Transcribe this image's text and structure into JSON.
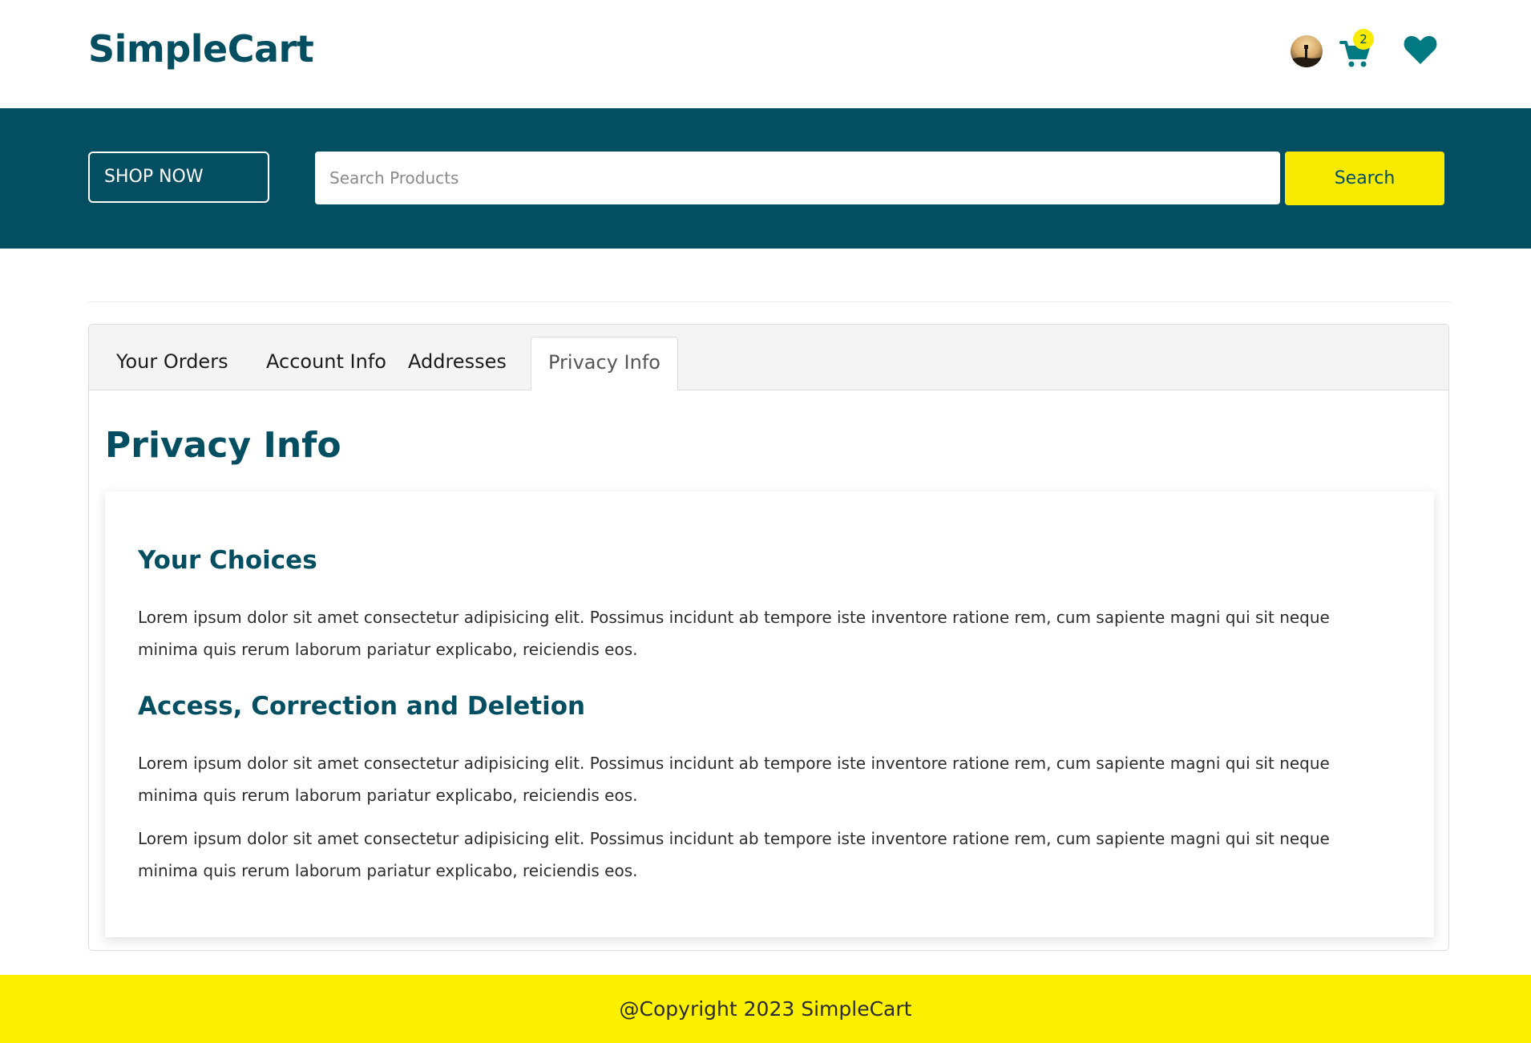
{
  "header": {
    "logo": "SimpleCart",
    "cart_count": "2",
    "icons": [
      "user-avatar",
      "cart-icon",
      "heart-icon"
    ]
  },
  "search_band": {
    "shop_now_label": "SHOP NOW",
    "search_placeholder": "Search Products",
    "search_value": "",
    "search_button_label": "Search"
  },
  "tabs": [
    {
      "label": "Your Orders",
      "active": false
    },
    {
      "label": "Account Info",
      "active": false
    },
    {
      "label": "Addresses",
      "active": false
    },
    {
      "label": "Privacy Info",
      "active": true
    }
  ],
  "content": {
    "title": "Privacy Info",
    "sections": [
      {
        "heading": "Your Choices",
        "paragraphs": [
          "Lorem ipsum dolor sit amet consectetur adipisicing elit. Possimus incidunt ab tempore iste inventore ratione rem, cum sapiente magni qui sit neque minima quis rerum laborum pariatur explicabo, reiciendis eos."
        ]
      },
      {
        "heading": "Access, Correction and Deletion",
        "paragraphs": [
          "Lorem ipsum dolor sit amet consectetur adipisicing elit. Possimus incidunt ab tempore iste inventore ratione rem, cum sapiente magni qui sit neque minima quis rerum laborum pariatur explicabo, reiciendis eos.",
          "Lorem ipsum dolor sit amet consectetur adipisicing elit. Possimus incidunt ab tempore iste inventore ratione rem, cum sapiente magni qui sit neque minima quis rerum laborum pariatur explicabo, reiciendis eos."
        ]
      }
    ]
  },
  "footer": {
    "text": "@Copyright 2023 SimpleCart"
  },
  "colors": {
    "brand": "#044e62",
    "accent": "#f8ea00",
    "footer_bg": "#fbf000",
    "icon": "#007a80"
  }
}
